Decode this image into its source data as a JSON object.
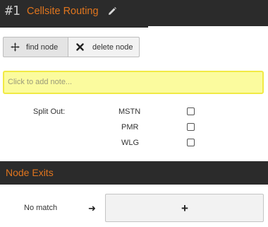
{
  "header": {
    "number": "#1",
    "title": "Cellsite Routing"
  },
  "toolbar": {
    "find_label": "find node",
    "delete_label": "delete node"
  },
  "note": {
    "placeholder": "Click to add note..."
  },
  "split_out": {
    "label": "Split Out:",
    "options": [
      {
        "name": "MSTN",
        "checked": false
      },
      {
        "name": "PMR",
        "checked": false
      },
      {
        "name": "WLG",
        "checked": false
      }
    ]
  },
  "exits": {
    "title": "Node Exits",
    "rows": [
      {
        "label": "No match",
        "arrow": "➜",
        "add": "+"
      }
    ]
  },
  "colors": {
    "accent": "#e0751e",
    "header_bg": "#2b2b2b",
    "note_bg": "#fbfb9e",
    "note_border": "#f1ea44"
  }
}
